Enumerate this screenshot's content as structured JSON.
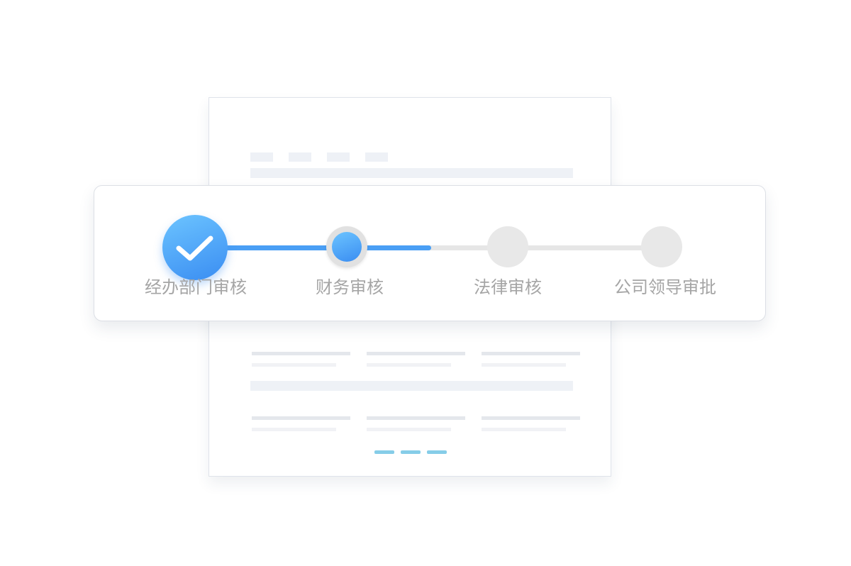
{
  "progress": {
    "steps": [
      {
        "label": "经办部门审核",
        "state": "done",
        "icon": "check-icon"
      },
      {
        "label": "财务审核",
        "state": "current"
      },
      {
        "label": "法律审核",
        "state": "pending"
      },
      {
        "label": "公司领导审批",
        "state": "pending"
      }
    ]
  },
  "colors": {
    "accent": "#3a8df2",
    "accent_light": "#6cc4ff",
    "pending": "#e8e8e8",
    "label": "#a5a5a5"
  }
}
